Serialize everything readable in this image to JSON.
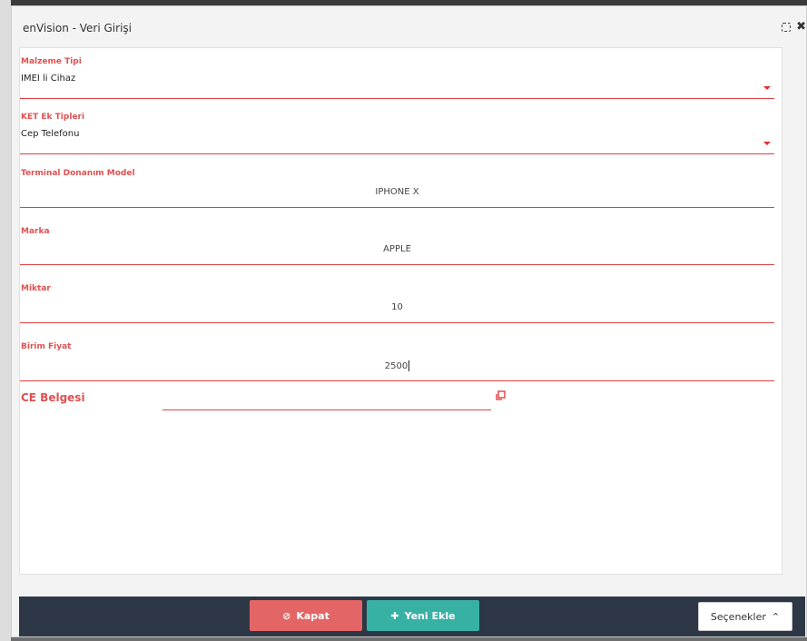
{
  "dialog": {
    "title": "enVision - Veri Girişi"
  },
  "form": {
    "material_type": {
      "label": "Malzeme Tipi",
      "value": "IMEI li Cihaz"
    },
    "ket_types": {
      "label": "KET Ek Tipleri",
      "value": "Cep Telefonu"
    },
    "terminal_model": {
      "label": "Terminal Donanım Model",
      "value": "IPHONE X"
    },
    "brand": {
      "label": "Marka",
      "value": "APPLE"
    },
    "quantity": {
      "label": "Miktar",
      "value": "10"
    },
    "unit_price": {
      "label": "Birim Fiyat",
      "value": "2500"
    },
    "ce_certificate": {
      "label": "CE Belgesi",
      "value": ""
    }
  },
  "footer": {
    "close_label": "Kapat",
    "add_label": "Yeni Ekle",
    "options_label": "Seçenekler"
  },
  "colors": {
    "accent": "#e05050",
    "close_button": "#e36565",
    "add_button": "#38b1a5",
    "footer_bg": "#2d3745"
  }
}
